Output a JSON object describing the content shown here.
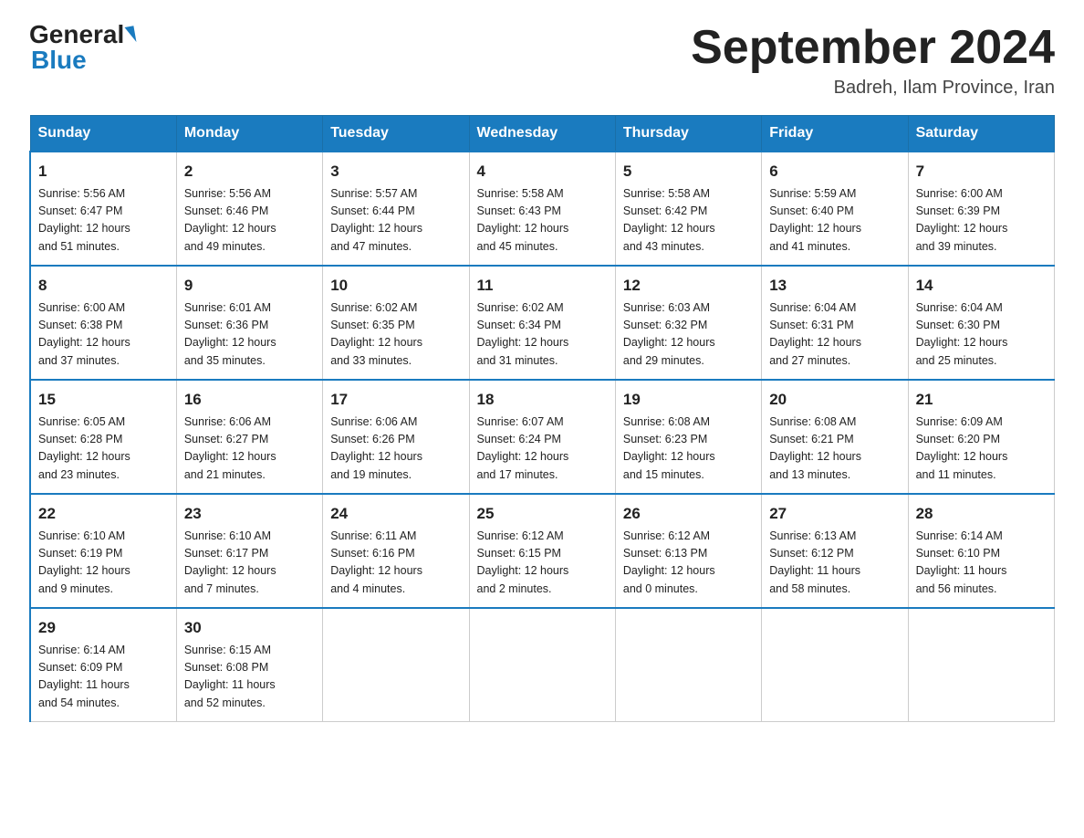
{
  "logo": {
    "general": "General",
    "blue": "Blue"
  },
  "title": {
    "month_year": "September 2024",
    "location": "Badreh, Ilam Province, Iran"
  },
  "header_days": [
    "Sunday",
    "Monday",
    "Tuesday",
    "Wednesday",
    "Thursday",
    "Friday",
    "Saturday"
  ],
  "weeks": [
    [
      {
        "day": "1",
        "sunrise": "5:56 AM",
        "sunset": "6:47 PM",
        "daylight": "12 hours and 51 minutes."
      },
      {
        "day": "2",
        "sunrise": "5:56 AM",
        "sunset": "6:46 PM",
        "daylight": "12 hours and 49 minutes."
      },
      {
        "day": "3",
        "sunrise": "5:57 AM",
        "sunset": "6:44 PM",
        "daylight": "12 hours and 47 minutes."
      },
      {
        "day": "4",
        "sunrise": "5:58 AM",
        "sunset": "6:43 PM",
        "daylight": "12 hours and 45 minutes."
      },
      {
        "day": "5",
        "sunrise": "5:58 AM",
        "sunset": "6:42 PM",
        "daylight": "12 hours and 43 minutes."
      },
      {
        "day": "6",
        "sunrise": "5:59 AM",
        "sunset": "6:40 PM",
        "daylight": "12 hours and 41 minutes."
      },
      {
        "day": "7",
        "sunrise": "6:00 AM",
        "sunset": "6:39 PM",
        "daylight": "12 hours and 39 minutes."
      }
    ],
    [
      {
        "day": "8",
        "sunrise": "6:00 AM",
        "sunset": "6:38 PM",
        "daylight": "12 hours and 37 minutes."
      },
      {
        "day": "9",
        "sunrise": "6:01 AM",
        "sunset": "6:36 PM",
        "daylight": "12 hours and 35 minutes."
      },
      {
        "day": "10",
        "sunrise": "6:02 AM",
        "sunset": "6:35 PM",
        "daylight": "12 hours and 33 minutes."
      },
      {
        "day": "11",
        "sunrise": "6:02 AM",
        "sunset": "6:34 PM",
        "daylight": "12 hours and 31 minutes."
      },
      {
        "day": "12",
        "sunrise": "6:03 AM",
        "sunset": "6:32 PM",
        "daylight": "12 hours and 29 minutes."
      },
      {
        "day": "13",
        "sunrise": "6:04 AM",
        "sunset": "6:31 PM",
        "daylight": "12 hours and 27 minutes."
      },
      {
        "day": "14",
        "sunrise": "6:04 AM",
        "sunset": "6:30 PM",
        "daylight": "12 hours and 25 minutes."
      }
    ],
    [
      {
        "day": "15",
        "sunrise": "6:05 AM",
        "sunset": "6:28 PM",
        "daylight": "12 hours and 23 minutes."
      },
      {
        "day": "16",
        "sunrise": "6:06 AM",
        "sunset": "6:27 PM",
        "daylight": "12 hours and 21 minutes."
      },
      {
        "day": "17",
        "sunrise": "6:06 AM",
        "sunset": "6:26 PM",
        "daylight": "12 hours and 19 minutes."
      },
      {
        "day": "18",
        "sunrise": "6:07 AM",
        "sunset": "6:24 PM",
        "daylight": "12 hours and 17 minutes."
      },
      {
        "day": "19",
        "sunrise": "6:08 AM",
        "sunset": "6:23 PM",
        "daylight": "12 hours and 15 minutes."
      },
      {
        "day": "20",
        "sunrise": "6:08 AM",
        "sunset": "6:21 PM",
        "daylight": "12 hours and 13 minutes."
      },
      {
        "day": "21",
        "sunrise": "6:09 AM",
        "sunset": "6:20 PM",
        "daylight": "12 hours and 11 minutes."
      }
    ],
    [
      {
        "day": "22",
        "sunrise": "6:10 AM",
        "sunset": "6:19 PM",
        "daylight": "12 hours and 9 minutes."
      },
      {
        "day": "23",
        "sunrise": "6:10 AM",
        "sunset": "6:17 PM",
        "daylight": "12 hours and 7 minutes."
      },
      {
        "day": "24",
        "sunrise": "6:11 AM",
        "sunset": "6:16 PM",
        "daylight": "12 hours and 4 minutes."
      },
      {
        "day": "25",
        "sunrise": "6:12 AM",
        "sunset": "6:15 PM",
        "daylight": "12 hours and 2 minutes."
      },
      {
        "day": "26",
        "sunrise": "6:12 AM",
        "sunset": "6:13 PM",
        "daylight": "12 hours and 0 minutes."
      },
      {
        "day": "27",
        "sunrise": "6:13 AM",
        "sunset": "6:12 PM",
        "daylight": "11 hours and 58 minutes."
      },
      {
        "day": "28",
        "sunrise": "6:14 AM",
        "sunset": "6:10 PM",
        "daylight": "11 hours and 56 minutes."
      }
    ],
    [
      {
        "day": "29",
        "sunrise": "6:14 AM",
        "sunset": "6:09 PM",
        "daylight": "11 hours and 54 minutes."
      },
      {
        "day": "30",
        "sunrise": "6:15 AM",
        "sunset": "6:08 PM",
        "daylight": "11 hours and 52 minutes."
      },
      null,
      null,
      null,
      null,
      null
    ]
  ],
  "labels": {
    "sunrise": "Sunrise: ",
    "sunset": "Sunset: ",
    "daylight": "Daylight: "
  }
}
